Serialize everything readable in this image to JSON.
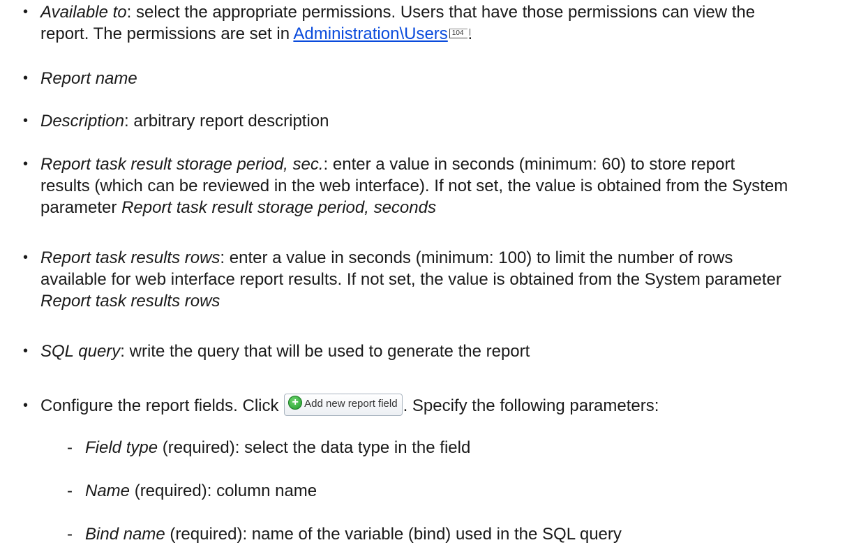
{
  "bullet": "•",
  "dash": "-",
  "items": [
    {
      "label": "Available to",
      "line1": ": select the appropriate permissions. Users that have those permissions can view the",
      "line2_before": "report. The permissions are set in ",
      "link": "Administration\\Users",
      "page_ref": "104",
      "line2_after": "."
    },
    {
      "label": "Report name"
    },
    {
      "label": "Description",
      "text": ": arbitrary report description"
    },
    {
      "label": "Report task result storage period, sec.",
      "line1": ": enter a value in seconds (minimum: 60) to store report",
      "line2": "results (which can be reviewed in the web interface). If not set, the value is obtained from the System",
      "line3_before": "parameter ",
      "line3_em": "Report task result storage period, seconds"
    },
    {
      "label": "Report task results rows",
      "line1": ": enter a value in seconds (minimum: 100) to limit the number of rows",
      "line2": "available for web interface report results. If not set, the value is obtained from the System parameter",
      "line3_em": "Report task results rows"
    },
    {
      "label": "SQL query",
      "text": ": write the query that will be used to generate the report"
    },
    {
      "before": "Configure the report fields. Click ",
      "button_label": "Add new report field",
      "after": ". Specify the following parameters:"
    }
  ],
  "sub_items": [
    {
      "label": "Field type",
      "text": " (required): select the data type in the field"
    },
    {
      "label": "Name",
      "text": " (required): column name"
    },
    {
      "label": "Bind name",
      "text": " (required): name of the variable (bind) used in the SQL query"
    }
  ],
  "icons": {
    "add_button_icon": "plus-circle-icon",
    "add_button_icon_color": "#1f9a2a"
  }
}
